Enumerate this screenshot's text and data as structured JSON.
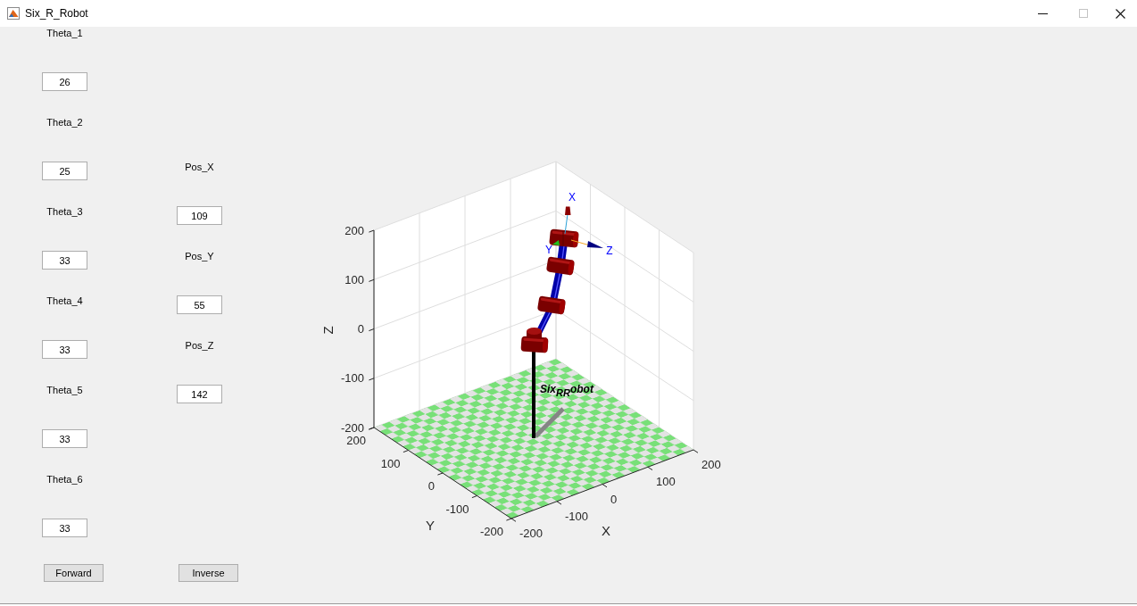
{
  "window": {
    "title": "Six_R_Robot",
    "controls": [
      {
        "kind": "minimize",
        "disabled": false
      },
      {
        "kind": "maximize",
        "disabled": true
      },
      {
        "kind": "close",
        "disabled": false
      }
    ]
  },
  "panels": [
    {
      "fields": [
        {
          "label": "Theta_1",
          "value": "26"
        },
        {
          "label": "Theta_2",
          "value": "25"
        },
        {
          "label": "Theta_3",
          "value": "33"
        },
        {
          "label": "Theta_4",
          "value": "33"
        },
        {
          "label": "Theta_5",
          "value": "33"
        },
        {
          "label": "Theta_6",
          "value": "33"
        }
      ],
      "button": "Forward"
    },
    {
      "fields": [
        {
          "label": "Pos_X",
          "value": "109"
        },
        {
          "label": "Pos_Y",
          "value": "55"
        },
        {
          "label": "Pos_Z",
          "value": "142"
        }
      ],
      "button": "Inverse"
    }
  ],
  "plot": {
    "z_label": "Z",
    "y_label": "Y",
    "x_label": "X",
    "z_tick_labels": [
      "200",
      "100",
      "0",
      "-100",
      "-200"
    ],
    "y_tick_labels": [
      "200",
      "100",
      "0",
      "-100",
      "-200"
    ],
    "x_tick_labels": [
      "-200",
      "-100",
      "0",
      "100",
      "200"
    ],
    "frame_labels": [
      "X",
      "Y",
      "Z"
    ],
    "annotation": "Six$_{RR}$obot"
  }
}
